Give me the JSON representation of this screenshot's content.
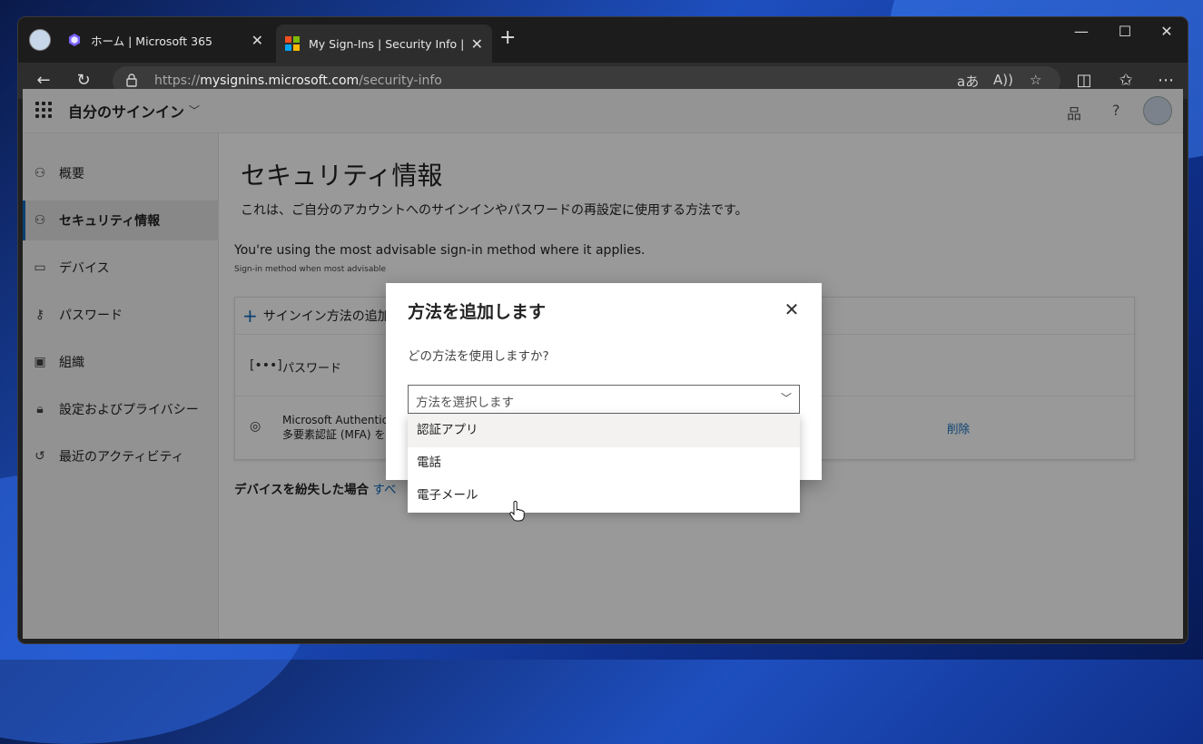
{
  "browser": {
    "tabs": [
      {
        "title": "ホーム | Microsoft 365",
        "active": false
      },
      {
        "title": "My Sign-Ins | Security Info | Micr",
        "active": true
      }
    ],
    "url_prefix": "https://",
    "url_host": "mysignins.microsoft.com",
    "url_path": "/security-info"
  },
  "appbar": {
    "title": "自分のサインイン"
  },
  "sidebar": {
    "items": [
      {
        "label": "概要",
        "icon": "person-icon"
      },
      {
        "label": "セキュリティ情報",
        "icon": "security-info-icon",
        "selected": true
      },
      {
        "label": "デバイス",
        "icon": "laptop-icon"
      },
      {
        "label": "パスワード",
        "icon": "key-icon"
      },
      {
        "label": "組織",
        "icon": "briefcase-icon"
      },
      {
        "label": "設定およびプライバシー",
        "icon": "lock-icon"
      },
      {
        "label": "最近のアクティビティ",
        "icon": "history-icon"
      }
    ]
  },
  "main": {
    "title": "セキュリティ情報",
    "description": "これは、ご自分のアカウントへのサインインやパスワードの再設定に使用する方法です。",
    "advisable": "You're using the most advisable sign-in method where it applies.",
    "advisable_sub": "Sign-in method when most advisable",
    "add_method_label": "サインイン方法の追加",
    "methods": [
      {
        "label": "パスワード",
        "icon": "password-dots-icon"
      },
      {
        "label_line1": "Microsoft Authenticat",
        "label_line2": "多要素認証 (MFA) をプ",
        "icon": "authenticator-icon",
        "action": "削除"
      }
    ],
    "lost_device_label": "デバイスを紛失した場合",
    "lost_device_link": "すべ"
  },
  "dialog": {
    "title": "方法を追加します",
    "question": "どの方法を使用しますか?",
    "select_placeholder": "方法を選択します",
    "options": [
      "認証アプリ",
      "電話",
      "電子メール"
    ],
    "hovered_option": "認証アプリ"
  },
  "colors": {
    "accent": "#0f6cbd",
    "browser_chrome": "#202020",
    "overlay": "rgba(0,0,0,0.40)"
  }
}
